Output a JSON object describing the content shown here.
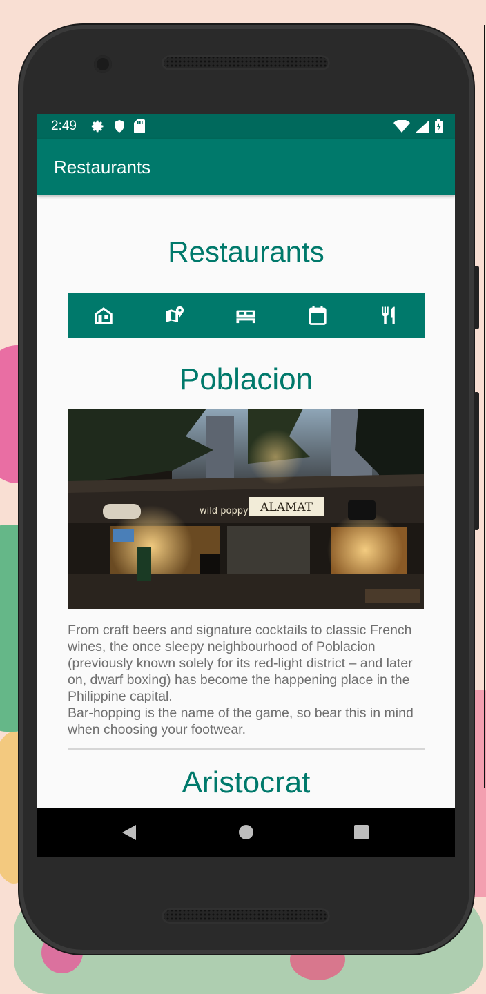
{
  "status_bar": {
    "time": "2:49",
    "left_icons": [
      "gear-icon",
      "shield-icon",
      "sd-card-icon"
    ],
    "right_icons": [
      "wifi-icon",
      "cell-signal-icon",
      "battery-icon"
    ]
  },
  "app_bar": {
    "title": "Restaurants"
  },
  "page": {
    "heading": "Restaurants",
    "nav_icons": [
      "home-icon",
      "map-pin-icon",
      "bed-icon",
      "calendar-icon",
      "restaurant-icon"
    ],
    "section": {
      "title": "Poblacion",
      "image_signs": [
        "ALAMAT",
        "wild poppy"
      ],
      "description": "From craft beers and signature cocktails to classic French wines, the once sleepy neighbourhood of Poblacion (previously known solely for its red-light district – and later on, dwarf boxing) has become the happening place in the Philippine capital.\n Bar-hopping is the name of the game, so bear this in mind when choosing your footwear."
    },
    "next_section_title": "Aristocrat"
  },
  "colors": {
    "primary": "#00796b",
    "primary_dark": "#00695c",
    "text_muted": "#6f6f6f"
  }
}
